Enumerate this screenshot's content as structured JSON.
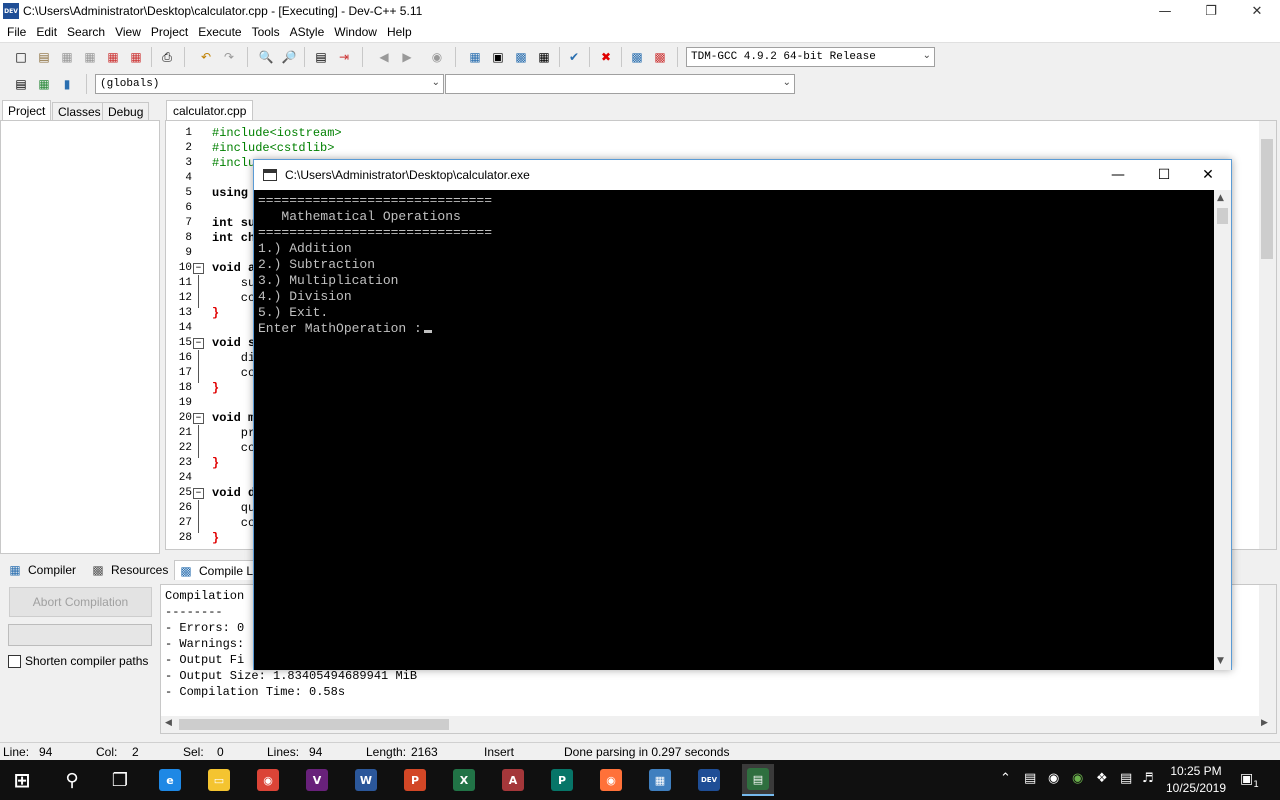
{
  "window": {
    "title": "C:\\Users\\Administrator\\Desktop\\calculator.cpp - [Executing] - Dev-C++ 5.11",
    "icon_label": "DEV"
  },
  "menu": [
    "File",
    "Edit",
    "Search",
    "View",
    "Project",
    "Execute",
    "Tools",
    "AStyle",
    "Window",
    "Help"
  ],
  "toolbar": {
    "compiler_select": "TDM-GCC 4.9.2 64-bit Release",
    "scope_select": "(globals)",
    "function_select": ""
  },
  "left_tabs": [
    "Project",
    "Classes",
    "Debug"
  ],
  "editor": {
    "tab": "calculator.cpp",
    "line_numbers": [
      "1",
      "2",
      "3",
      "4",
      "5",
      "6",
      "7",
      "8",
      "9",
      "10",
      "11",
      "12",
      "13",
      "14",
      "15",
      "16",
      "17",
      "18",
      "19",
      "20",
      "21",
      "22",
      "23",
      "24",
      "25",
      "26",
      "27",
      "28"
    ],
    "lines": [
      "#include<iostream>",
      "#include<cstdlib>",
      "#inclu",
      "",
      "using",
      "",
      "int su",
      "int ch",
      "",
      "void a",
      "    su",
      "    co",
      "}",
      "",
      "void s",
      "    di",
      "    co",
      "}",
      "",
      "void m",
      "    pr",
      "    co",
      "}",
      "",
      "void d",
      "    qu",
      "    co",
      "}"
    ]
  },
  "bottom_tabs": [
    "Compiler",
    "Resources",
    "Compile L"
  ],
  "compiler_panel": {
    "abort_button": "Abort Compilation",
    "shorten_paths": "Shorten compiler paths"
  },
  "log_lines": [
    "Compilation",
    "--------",
    "- Errors: 0",
    "- Warnings:",
    "- Output Fi",
    "- Output Size: 1.83405494689941 MiB",
    "- Compilation Time: 0.58s"
  ],
  "status": {
    "line_label": "Line:",
    "line": "94",
    "col_label": "Col:",
    "col": "2",
    "sel_label": "Sel:",
    "sel": "0",
    "lines_label": "Lines:",
    "lines": "94",
    "length_label": "Length:",
    "length": "2163",
    "mode": "Insert",
    "message": "Done parsing in 0.297 seconds"
  },
  "console": {
    "title": "C:\\Users\\Administrator\\Desktop\\calculator.exe",
    "lines": [
      "==============================",
      "   Mathematical Operations",
      "==============================",
      "1.) Addition",
      "2.) Subtraction",
      "3.) Multiplication",
      "4.) Division",
      "5.) Exit.",
      "Enter MathOperation :"
    ]
  },
  "taskbar": {
    "apps": [
      {
        "name": "Internet Explorer",
        "label": "e",
        "color": "#1e88e5"
      },
      {
        "name": "File Explorer",
        "label": "▭",
        "color": "#f4c430"
      },
      {
        "name": "Chrome",
        "label": "◉",
        "color": "#db4437"
      },
      {
        "name": "Visual Studio",
        "label": "V",
        "color": "#68217a"
      },
      {
        "name": "Word",
        "label": "W",
        "color": "#2b579a"
      },
      {
        "name": "PowerPoint",
        "label": "P",
        "color": "#d24726"
      },
      {
        "name": "Excel",
        "label": "X",
        "color": "#217346"
      },
      {
        "name": "Access",
        "label": "A",
        "color": "#a4373a"
      },
      {
        "name": "Publisher",
        "label": "P",
        "color": "#077568"
      },
      {
        "name": "Firefox",
        "label": "◉",
        "color": "#ff7139"
      },
      {
        "name": "Control Panel",
        "label": "▦",
        "color": "#3f7fbf"
      },
      {
        "name": "Dev-C++",
        "label": "DEV",
        "color": "#1f4e96"
      },
      {
        "name": "Console",
        "label": "▤",
        "color": "#2f6f3f"
      }
    ],
    "time": "10:25 PM",
    "date": "10/25/2019",
    "notifications": "1"
  }
}
